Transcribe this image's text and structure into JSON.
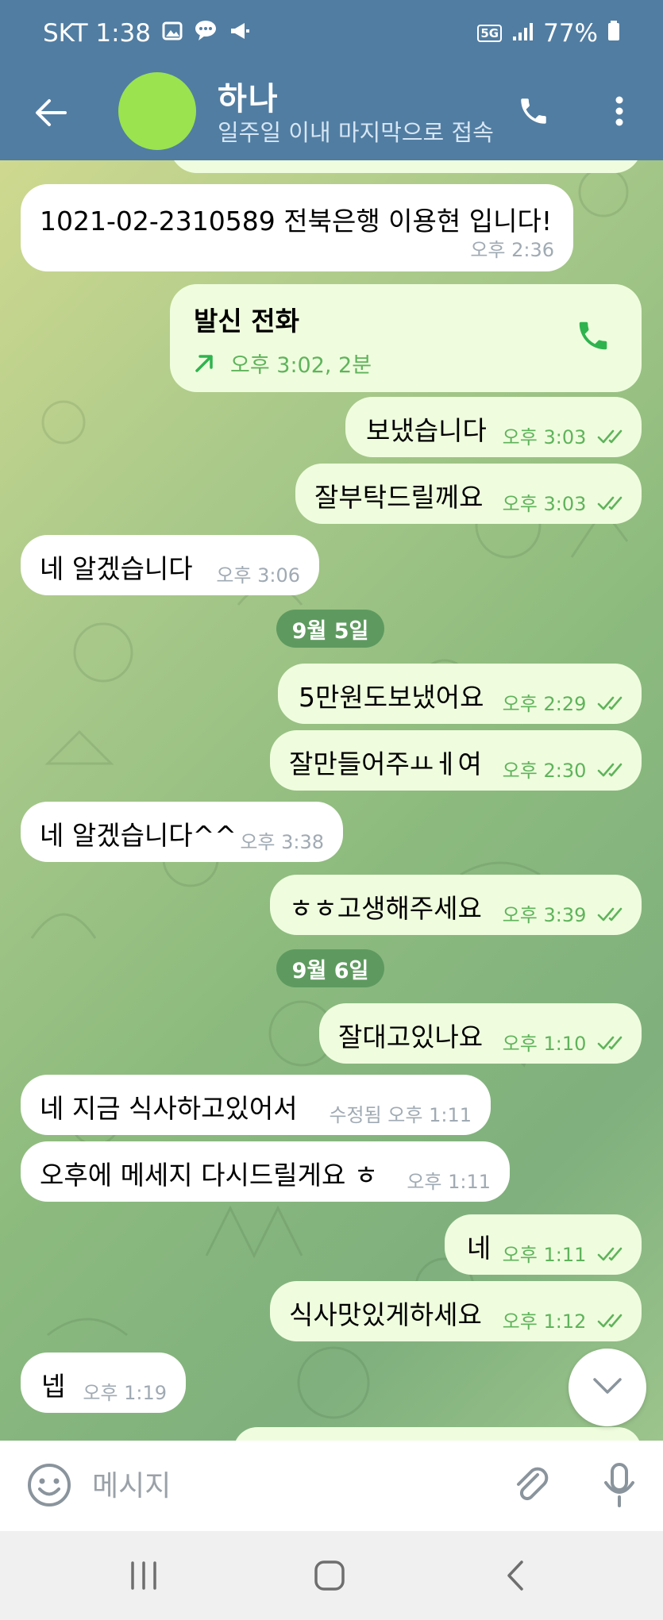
{
  "status_bar": {
    "carrier_time": "SKT 1:38",
    "network": "5G",
    "battery": "77%"
  },
  "header": {
    "contact_name": "하나",
    "contact_status": "일주일 이내 마지막으로 접속"
  },
  "messages": [
    {
      "text": "1021-02-2310589 전북은행 이용현 입니다!",
      "time": "오후 2:36"
    },
    {
      "title": "발신 전화",
      "detail": "오후 3:02, 2분"
    },
    {
      "text": "보냈습니다",
      "time": "오후 3:03"
    },
    {
      "text": "잘부탁드릴께요",
      "time": "오후 3:03"
    },
    {
      "text": "네 알겠습니다",
      "time": "오후 3:06"
    },
    {
      "text": "5만원도보냈어요",
      "time": "오후 2:29"
    },
    {
      "text": "잘만들어주ㅛㅔ여",
      "time": "오후 2:30"
    },
    {
      "text": "네 알겠습니다^^",
      "time": "오후 3:38"
    },
    {
      "text": "ㅎㅎ고생해주세요",
      "time": "오후 3:39"
    },
    {
      "text": "잘대고있나요",
      "time": "오후 1:10"
    },
    {
      "text": "네 지금 식사하고있어서",
      "time": "수정됨 오후 1:11"
    },
    {
      "text": "오후에 메세지 다시드릴게요 ㅎ",
      "time": "오후 1:11"
    },
    {
      "text": "네",
      "time": "오후 1:11"
    },
    {
      "text": "식사맛있게하세요",
      "time": "오후 1:12"
    },
    {
      "text": "넵",
      "time": "오후 1:19"
    }
  ],
  "date_dividers": [
    "9월 5일",
    "9월 6일"
  ],
  "composer": {
    "placeholder": "메시지"
  },
  "icons": {
    "back": "arrow-left-icon",
    "call": "phone-icon",
    "menu": "more-vertical-icon",
    "emoji": "emoji-icon",
    "attach": "paperclip-icon",
    "mic": "microphone-icon",
    "scroll_down": "chevron-down-icon"
  },
  "colors": {
    "header": "#517da2",
    "incoming_bubble": "#ffffff",
    "outgoing_bubble": "#effdde",
    "outgoing_meta": "#5fb35b",
    "date_pill": "#5e9a5f",
    "avatar": "#9be34f"
  }
}
